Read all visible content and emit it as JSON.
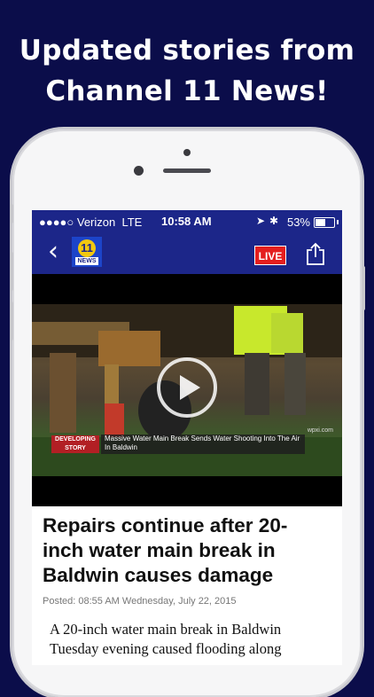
{
  "promo": {
    "headline_line1": "Updated stories from",
    "headline_line2": "Channel 11 News!"
  },
  "status_bar": {
    "carrier": "●●●●○ Verizon",
    "network": "LTE",
    "time": "10:58 AM",
    "battery": "53%",
    "battery_level": 0.53
  },
  "nav": {
    "back_icon": "chevron-left-icon",
    "logo_number": "11",
    "logo_text": "NEWS",
    "live_label": "LIVE",
    "share_icon": "share-icon"
  },
  "video": {
    "tag": "DEVELOPING STORY",
    "caption": "Massive Water Main Break Sends Water Shooting Into The Air In Baldwin",
    "watermark": "wpxi.com",
    "play_icon": "play-icon"
  },
  "article": {
    "title": "Repairs continue after 20-inch water main break in Baldwin causes damage",
    "posted": "Posted: 08:55 AM Wednesday, July 22, 2015",
    "body": "A 20-inch water main break in Baldwin Tuesday evening caused flooding along"
  },
  "colors": {
    "navy": "#1c2689",
    "live_red": "#e41e1e",
    "page_bg": "#0b0d4a"
  }
}
